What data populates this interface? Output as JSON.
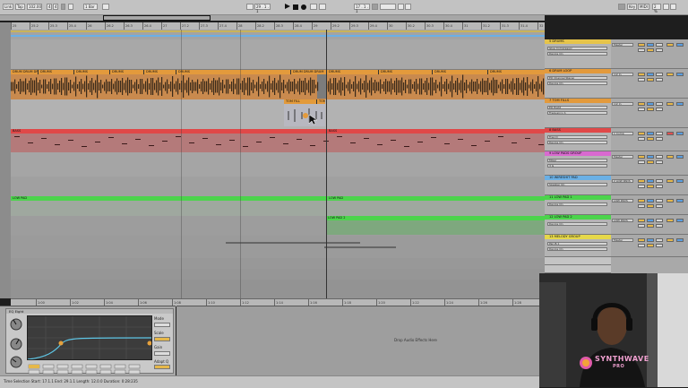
{
  "transport": {
    "link": "Link",
    "tap": "Tap",
    "tempo": "102.00",
    "time_sig_num": "4",
    "time_sig_den": "4",
    "quantize": "1 Bar",
    "position": "29 . 1 . 1",
    "position2": "17 . 1 . 1",
    "key": "Key",
    "midi": "MIDI",
    "cpu": "2 %"
  },
  "ruler_ticks": [
    "25",
    "25.2",
    "25.3",
    "25.4",
    "26",
    "26.2",
    "26.3",
    "26.4",
    "27",
    "27.2",
    "27.3",
    "27.4",
    "28",
    "28.2",
    "28.3",
    "28.4",
    "29",
    "29.2",
    "29.3",
    "29.4",
    "30",
    "30.2",
    "30.3",
    "30.4",
    "31",
    "31.2",
    "31.3",
    "31.4",
    "32"
  ],
  "lower_ticks": [
    "1:00",
    "1:02",
    "1:04",
    "1:06",
    "1:08",
    "1:10",
    "1:12",
    "1:14",
    "1:16",
    "1:18",
    "1:20",
    "1:22",
    "1:24",
    "1:26",
    "1:28"
  ],
  "clips": {
    "drums_a": "DRUM DRUM DRUM",
    "drums_b": "DRUMS",
    "drums_c": "DRUMS",
    "drums_d": "DRUMS",
    "drums_e": "DRUMS",
    "drums_f": "DRUMS",
    "drums_g": "DRUM DRUM DRUM",
    "drums_h": "DRUMS",
    "drums_i": "DRUMS",
    "drums_j": "DRUMS",
    "drums_k": "DRUMS",
    "tom_fill": "TOM FILL",
    "tom_fill2": "TOM",
    "bass_a": "BASS",
    "bass_b": "BASS",
    "low_pad": "LOW PAD",
    "low_pad_b": "LOW PAD",
    "low_pad2": "LOW PAD 2"
  },
  "tracks": [
    {
      "title": "5 DRUMS",
      "color": "#e6c44a",
      "dev1": "Glue Compressor",
      "dev2": "Device On"
    },
    {
      "title": "6 DRUM LOOP",
      "color": "#e39a3c",
      "dev1": "EQ Channel Stereo",
      "dev2": "Device On"
    },
    {
      "title": "7 TOM FILLS",
      "color": "#e39a3c",
      "dev1": "EQ Eight",
      "dev2": "Frequency A"
    },
    {
      "title": "8 BASS",
      "color": "#e04848",
      "dev1": "Freq D",
      "dev2": "Device On"
    },
    {
      "title": "9 LOW PADS GROUP",
      "color": "#d96ad0",
      "dev1": "Mixer",
      "dev2": "3 G"
    },
    {
      "title": "10 WIRESHIT PAD",
      "color": "#6ab0e6",
      "dev1": "Speaker On",
      "dev2": ""
    },
    {
      "title": "11 LOW PAD 1",
      "color": "#4cd44c",
      "dev1": "Device On",
      "dev2": ""
    },
    {
      "title": "12 LOW PAD 2",
      "color": "#4cd44c",
      "dev1": "Device On",
      "dev2": ""
    },
    {
      "title": "13 MELODY GROUP",
      "color": "#e6d84a",
      "dev1": "Pan B.1",
      "dev2": "Device On"
    }
  ],
  "mixer_labels": [
    "Master",
    "1/2 In",
    "1/2 In",
    "1 Comp",
    "Master",
    "2 LOW PADS",
    "LOW PADS",
    "LOW PADS",
    "Master"
  ],
  "device": {
    "title": "EQ Eight",
    "mode": "Mode",
    "scale": "Scale",
    "gain": "Gain",
    "adapt_q": "Adapt Q"
  },
  "drop_hint": "Drop Audio Effects Here",
  "status": "Time Selection   Start: 17.1.1   End: 29.1.1   Length: 12.0.0  Duration: 0:28:235",
  "logo": {
    "line1": "SYNTHWAVE",
    "line2": "PRO"
  },
  "colors": {
    "drums": "#e39a3c",
    "bass": "#e04848",
    "pad": "#4cd44c",
    "group": "#d96ad0"
  }
}
